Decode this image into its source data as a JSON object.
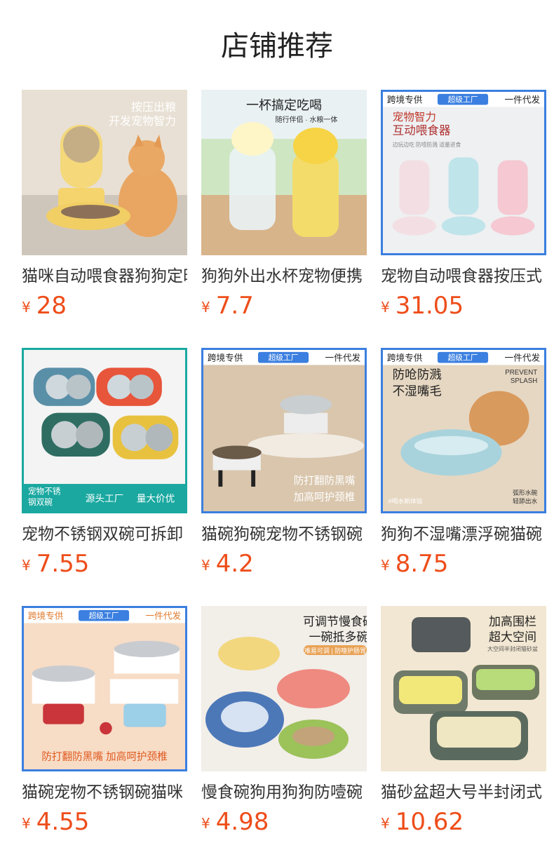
{
  "header": {
    "title": "店铺推荐"
  },
  "products": [
    {
      "title": "猫咪自动喂食器狗狗定时",
      "currency": "¥",
      "price": "28",
      "badges": [
        "按压出粮",
        "开发宠物智力"
      ]
    },
    {
      "title": "狗狗外出水杯宠物便携",
      "currency": "¥",
      "price": "7.7",
      "badges": [
        "一杯搞定吃喝",
        "随行伴侣 · 水粮一体"
      ]
    },
    {
      "title": "宠物自动喂食器按压式",
      "currency": "¥",
      "price": "31.05",
      "badges": [
        "跨境专供",
        "超级工厂",
        "一件代发",
        "宠物智力",
        "互动喂食器",
        "边玩边吃 防噎防溅 适量进食"
      ]
    },
    {
      "title": "宠物不锈钢双碗可拆卸",
      "currency": "¥",
      "price": "7.55",
      "badges": [
        "宠物不锈",
        "钢双碗",
        "源头工厂",
        "量大价优"
      ]
    },
    {
      "title": "猫碗狗碗宠物不锈钢碗",
      "currency": "¥",
      "price": "4.2",
      "badges": [
        "跨境专供",
        "超级工厂",
        "一件代发",
        "防打翻防黑嘴",
        "加高呵护颈椎"
      ]
    },
    {
      "title": "狗狗不湿嘴漂浮碗猫碗",
      "currency": "¥",
      "price": "8.75",
      "badges": [
        "跨境专供",
        "超级工厂",
        "一件代发",
        "防呛防溅",
        "不湿嘴毛",
        "PREVENT",
        "SPLASH",
        "#喝水新体验",
        "弧形水碗",
        "轻舔出水"
      ]
    },
    {
      "title": "猫碗宠物不锈钢碗猫咪",
      "currency": "¥",
      "price": "4.55",
      "badges": [
        "跨境专供",
        "超级工厂",
        "一件代发",
        "防打翻防黑嘴",
        "加高呵护颈椎"
      ]
    },
    {
      "title": "慢食碗狗用狗狗防噎碗",
      "currency": "¥",
      "price": "4.98",
      "badges": [
        "可调节慢食碗",
        "一碗抵多碗",
        "难易可调 | 防噎护肠胃"
      ]
    },
    {
      "title": "猫砂盆超大号半封闭式",
      "currency": "¥",
      "price": "10.62",
      "badges": [
        "加高围栏",
        "超大空间",
        "大空间半封闭猫砂盆"
      ]
    }
  ],
  "colors": {
    "price": "#ee4d1a",
    "frame_blue": "#3b7fe0",
    "frame_teal": "#1aa8a0"
  }
}
